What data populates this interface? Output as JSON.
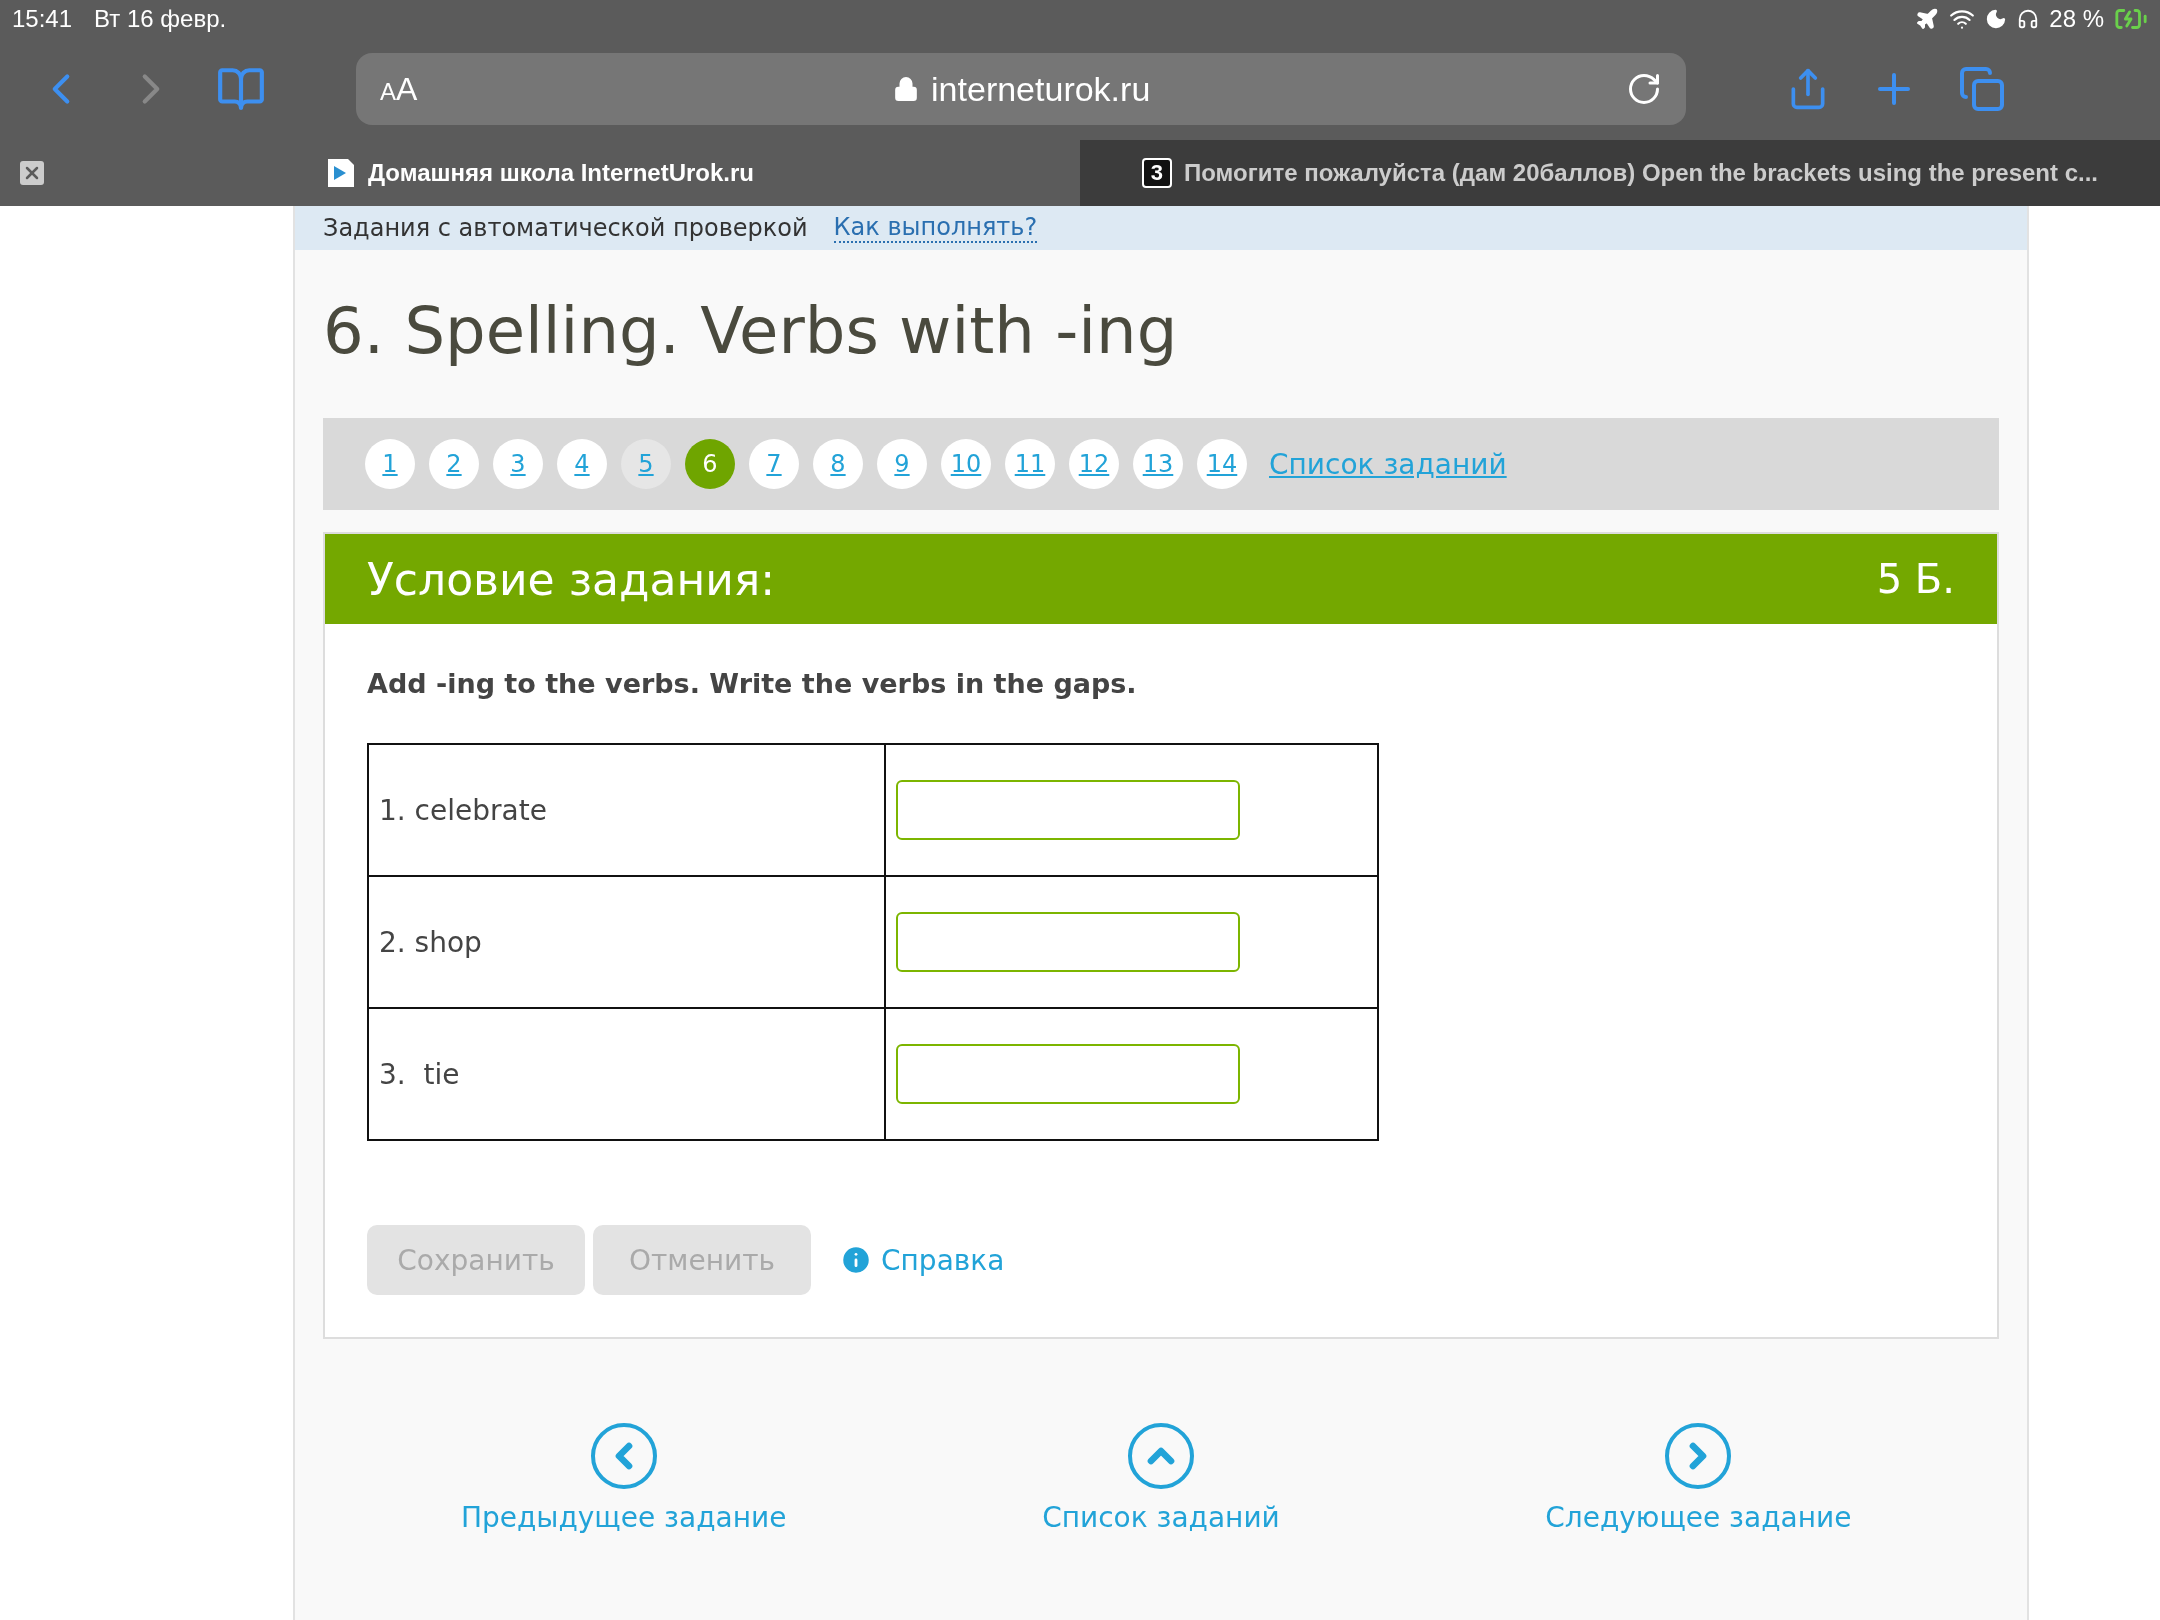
{
  "status_bar": {
    "time": "15:41",
    "date": "Вт 16 февр.",
    "battery": "28 %"
  },
  "toolbar": {
    "text_size_button": "AA",
    "url": "interneturok.ru"
  },
  "tabs": [
    {
      "title": "Домашняя школа InternetUrok.ru",
      "selected": true
    },
    {
      "title": "Помогите пожалуйста (дам 20баллов) Open the brackets using the present c...",
      "icon": "3",
      "selected": false
    }
  ],
  "info_strip": {
    "text": "Задания с автоматической проверкой",
    "link": "Как выполнять?"
  },
  "title": "6. Spelling. Verbs with -ing",
  "pagination": {
    "pages": [
      {
        "label": "1",
        "selected": false,
        "visited": false
      },
      {
        "label": "2",
        "selected": false,
        "visited": false
      },
      {
        "label": "3",
        "selected": false,
        "visited": false
      },
      {
        "label": "4",
        "selected": false,
        "visited": false
      },
      {
        "label": "5",
        "selected": false,
        "visited": true
      },
      {
        "label": "6",
        "selected": true,
        "visited": false
      },
      {
        "label": "7",
        "selected": false,
        "visited": false
      },
      {
        "label": "8",
        "selected": false,
        "visited": false
      },
      {
        "label": "9",
        "selected": false,
        "visited": false
      },
      {
        "label": "10",
        "selected": false,
        "visited": false
      },
      {
        "label": "11",
        "selected": false,
        "visited": false
      },
      {
        "label": "12",
        "selected": false,
        "visited": false
      },
      {
        "label": "13",
        "selected": false,
        "visited": false
      },
      {
        "label": "14",
        "selected": false,
        "visited": false
      }
    ],
    "list_link": "Список заданий"
  },
  "task": {
    "header": "Условие задания:",
    "points": "5 Б.",
    "instruction": "Add -ing to the verbs. Write the verbs in the gaps.",
    "rows": [
      {
        "word": "1. celebrate"
      },
      {
        "word": "2. shop"
      },
      {
        "word": "3.  tie"
      }
    ],
    "buttons": [
      {
        "label": "Сохранить",
        "disabled": true
      },
      {
        "label": "Отменить",
        "disabled": true
      }
    ],
    "help_link": "Справка"
  },
  "nav": [
    {
      "kind": "prev",
      "label": "Предыдущее задание"
    },
    {
      "kind": "up",
      "label": "Список заданий"
    },
    {
      "kind": "next",
      "label": "Следующее задание"
    }
  ]
}
